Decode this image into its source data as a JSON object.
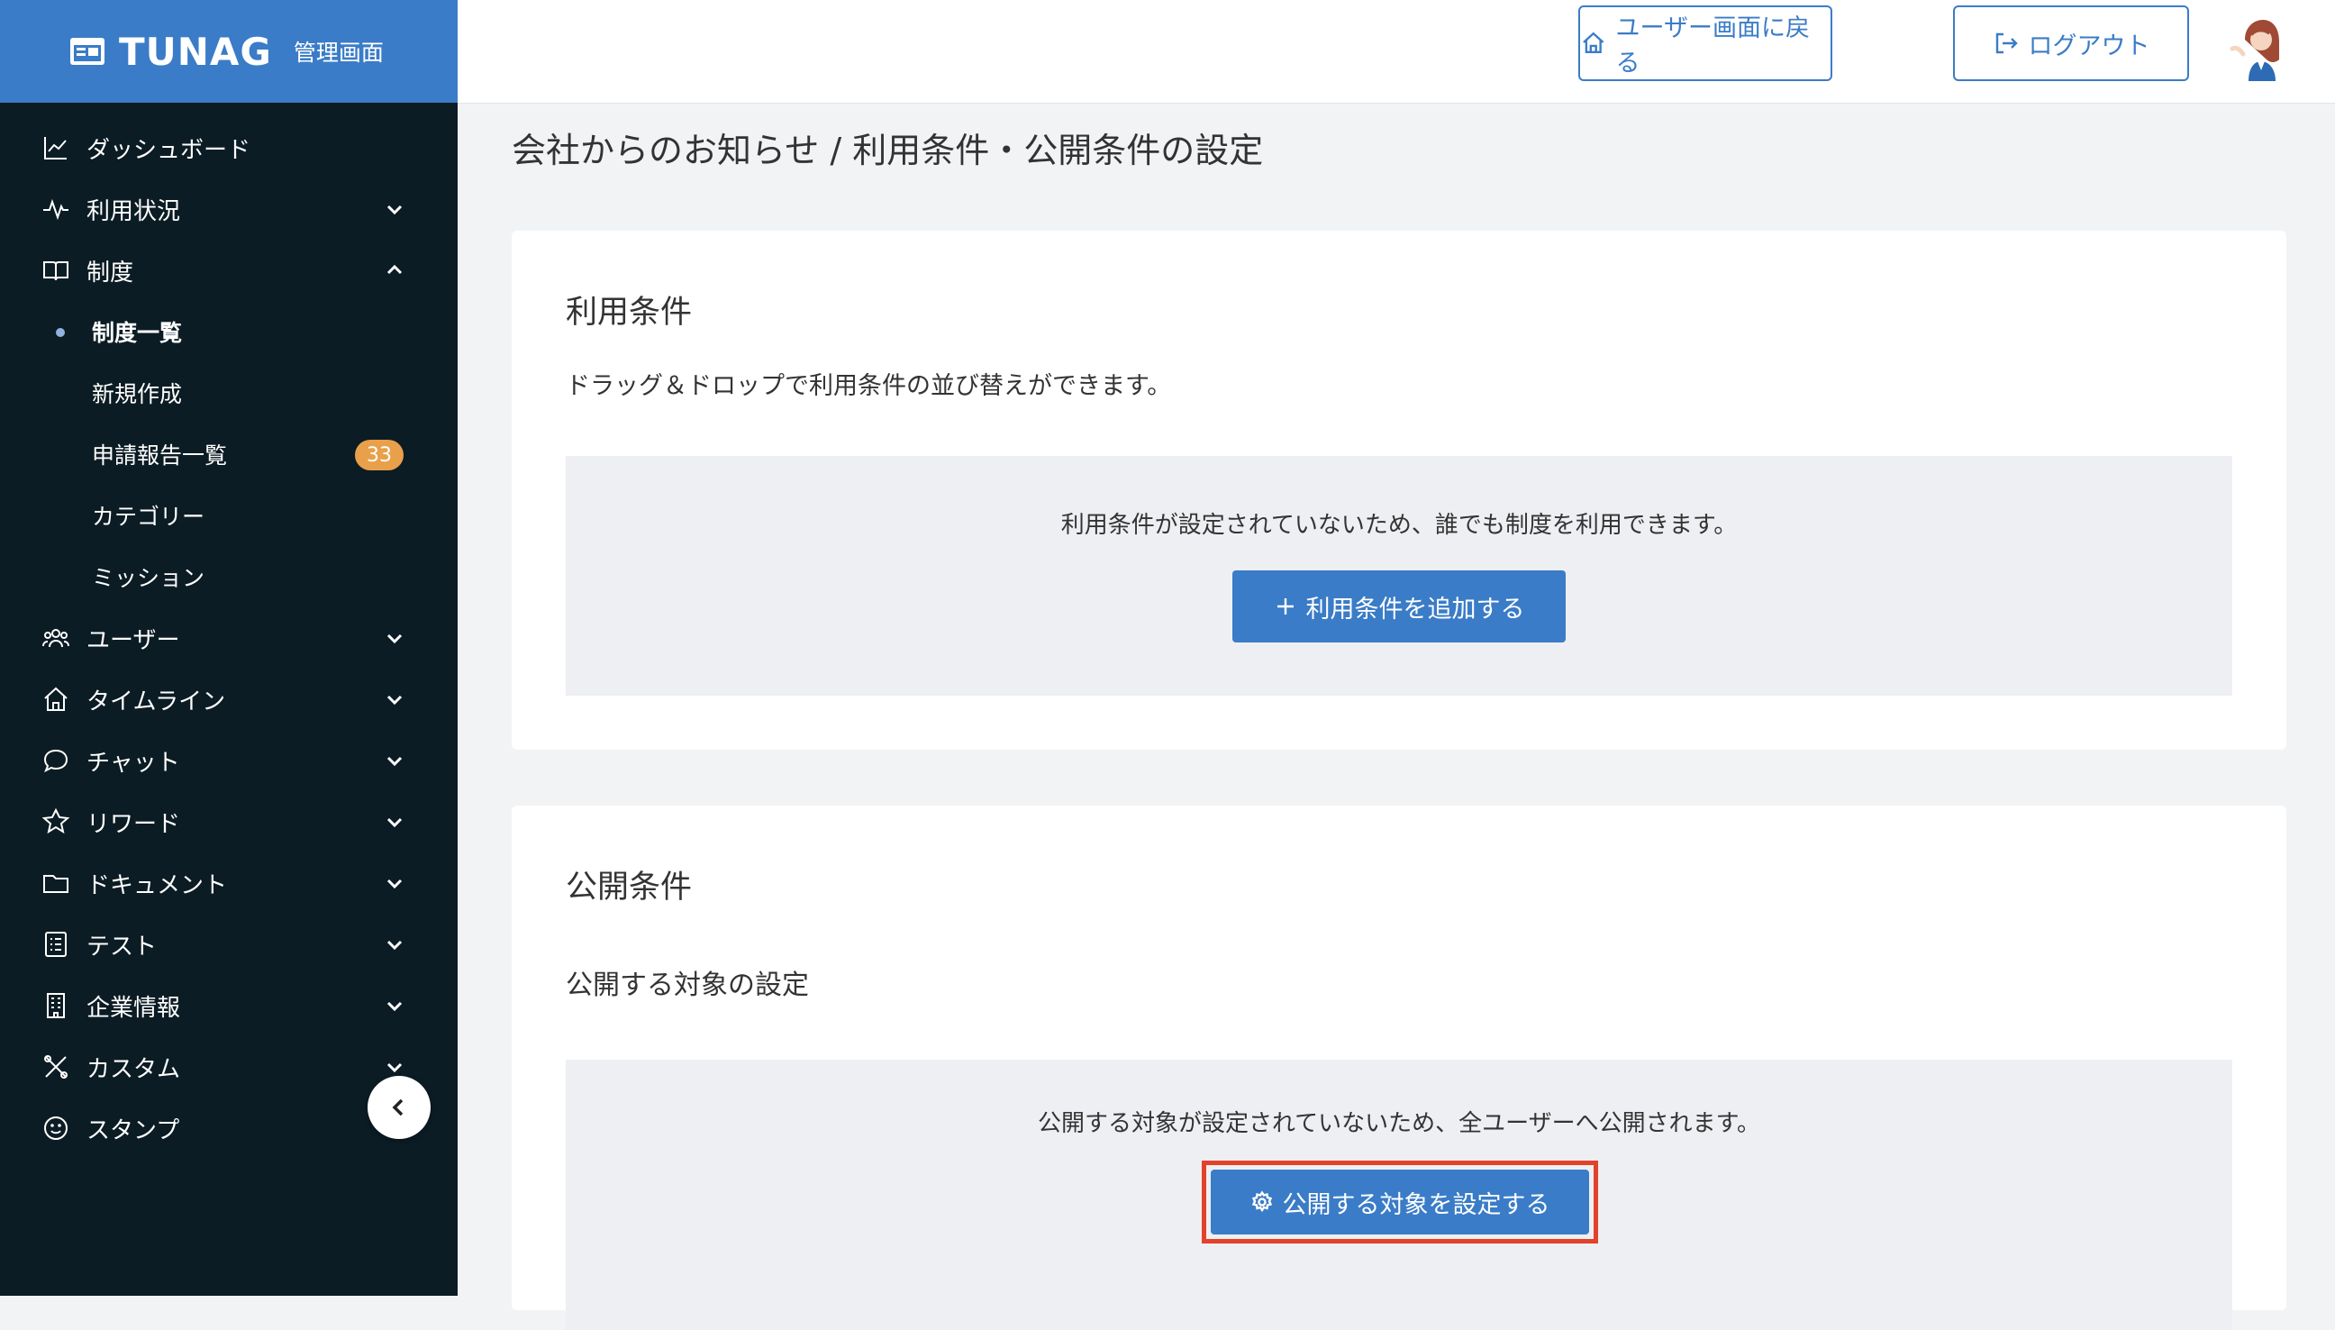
{
  "brand": {
    "name": "TUNAG",
    "subtitle": "管理画面"
  },
  "sidebar": {
    "items": [
      {
        "label": "ダッシュボード",
        "icon": "chart-line-icon"
      },
      {
        "label": "利用状況",
        "icon": "activity-icon"
      },
      {
        "label": "制度",
        "icon": "book-icon"
      },
      {
        "label": "ユーザー",
        "icon": "users-icon"
      },
      {
        "label": "タイムライン",
        "icon": "home-icon"
      },
      {
        "label": "チャット",
        "icon": "chat-bubble-icon"
      },
      {
        "label": "リワード",
        "icon": "star-icon"
      },
      {
        "label": "ドキュメント",
        "icon": "folder-icon"
      },
      {
        "label": "テスト",
        "icon": "checklist-icon"
      },
      {
        "label": "企業情報",
        "icon": "building-icon"
      },
      {
        "label": "カスタム",
        "icon": "tools-icon"
      },
      {
        "label": "スタンプ",
        "icon": "smile-icon"
      }
    ],
    "sub_items": [
      {
        "label": "制度一覧"
      },
      {
        "label": "新規作成"
      },
      {
        "label": "申請報告一覧",
        "badge": "33"
      },
      {
        "label": "カテゴリー"
      },
      {
        "label": "ミッション"
      }
    ]
  },
  "header": {
    "user_screen_button": "ユーザー画面に戻る",
    "logout_button": "ログアウト"
  },
  "main": {
    "page_title": "会社からのお知らせ / 利用条件・公開条件の設定",
    "terms": {
      "title": "利用条件",
      "description": "ドラッグ＆ドロップで利用条件の並び替えができます。",
      "empty_message": "利用条件が設定されていないため、誰でも制度を利用できます。",
      "add_button": "利用条件を追加する"
    },
    "publication": {
      "title": "公開条件",
      "subtitle": "公開する対象の設定",
      "empty_message": "公開する対象が設定されていないため、全ユーザーへ公開されます。",
      "set_button": "公開する対象を設定する"
    }
  },
  "colors": {
    "brand_blue": "#3a7cc7",
    "sidebar_bg": "#0c1c24",
    "badge_orange": "#e8a04a",
    "highlight_red": "#e2422a"
  }
}
